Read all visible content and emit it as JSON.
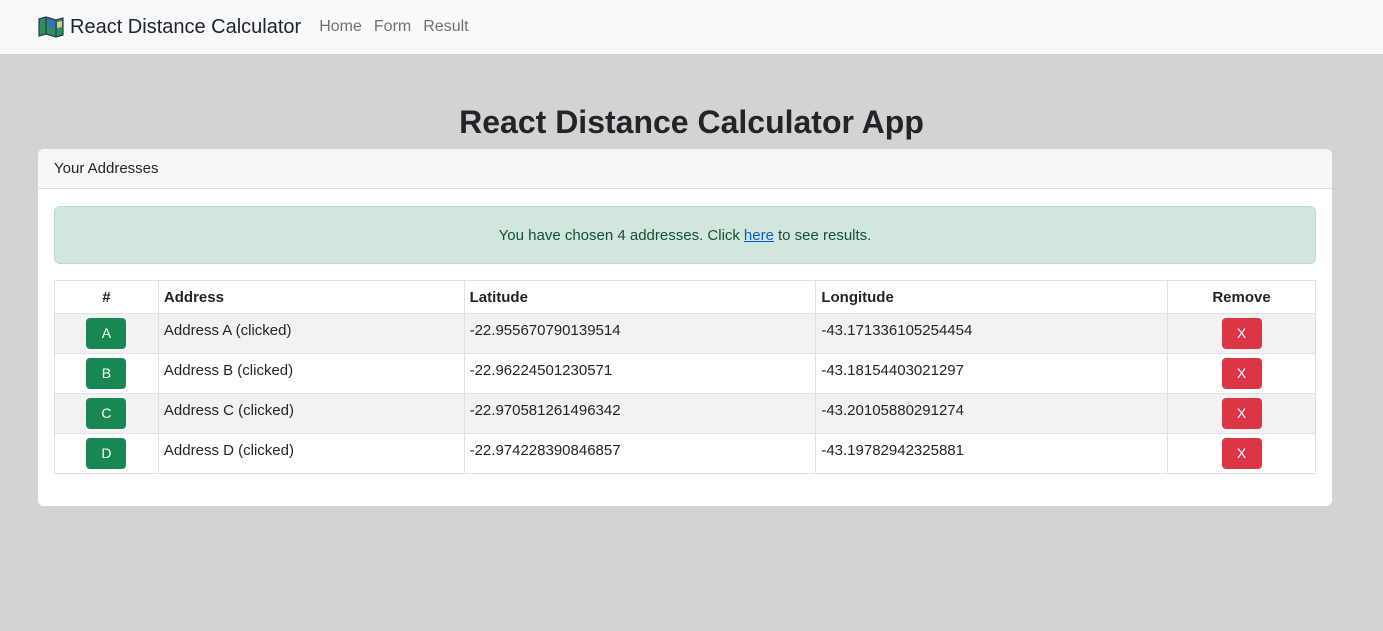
{
  "navbar": {
    "brand_icon": "map-icon",
    "brand": "React Distance Calculator",
    "links": [
      "Home",
      "Form",
      "Result"
    ]
  },
  "title": "React Distance Calculator App",
  "card": {
    "header": "Your Addresses",
    "alert": {
      "before": "You have chosen 4 addresses. Click",
      "link": "here",
      "after": "to see results."
    },
    "table": {
      "headers": [
        "#",
        "Address",
        "Latitude",
        "Longitude",
        "Remove"
      ],
      "rows": [
        {
          "letter": "A",
          "address": "Address A (clicked)",
          "lat": "-22.955670790139514",
          "lng": "-43.171336105254454",
          "remove": "X"
        },
        {
          "letter": "B",
          "address": "Address B (clicked)",
          "lat": "-22.96224501230571",
          "lng": "-43.18154403021297",
          "remove": "X"
        },
        {
          "letter": "C",
          "address": "Address C (clicked)",
          "lat": "-22.970581261496342",
          "lng": "-43.20105880291274",
          "remove": "X"
        },
        {
          "letter": "D",
          "address": "Address D (clicked)",
          "lat": "-22.974228390846857",
          "lng": "-43.19782942325881",
          "remove": "X"
        }
      ]
    }
  },
  "colors": {
    "navbar_bg": "#f8f9fa",
    "page_bg": "#d3d3d3",
    "success": "#198754",
    "danger": "#dc3545",
    "alert_bg": "#d1e7dd",
    "link": "#0a58ca"
  }
}
